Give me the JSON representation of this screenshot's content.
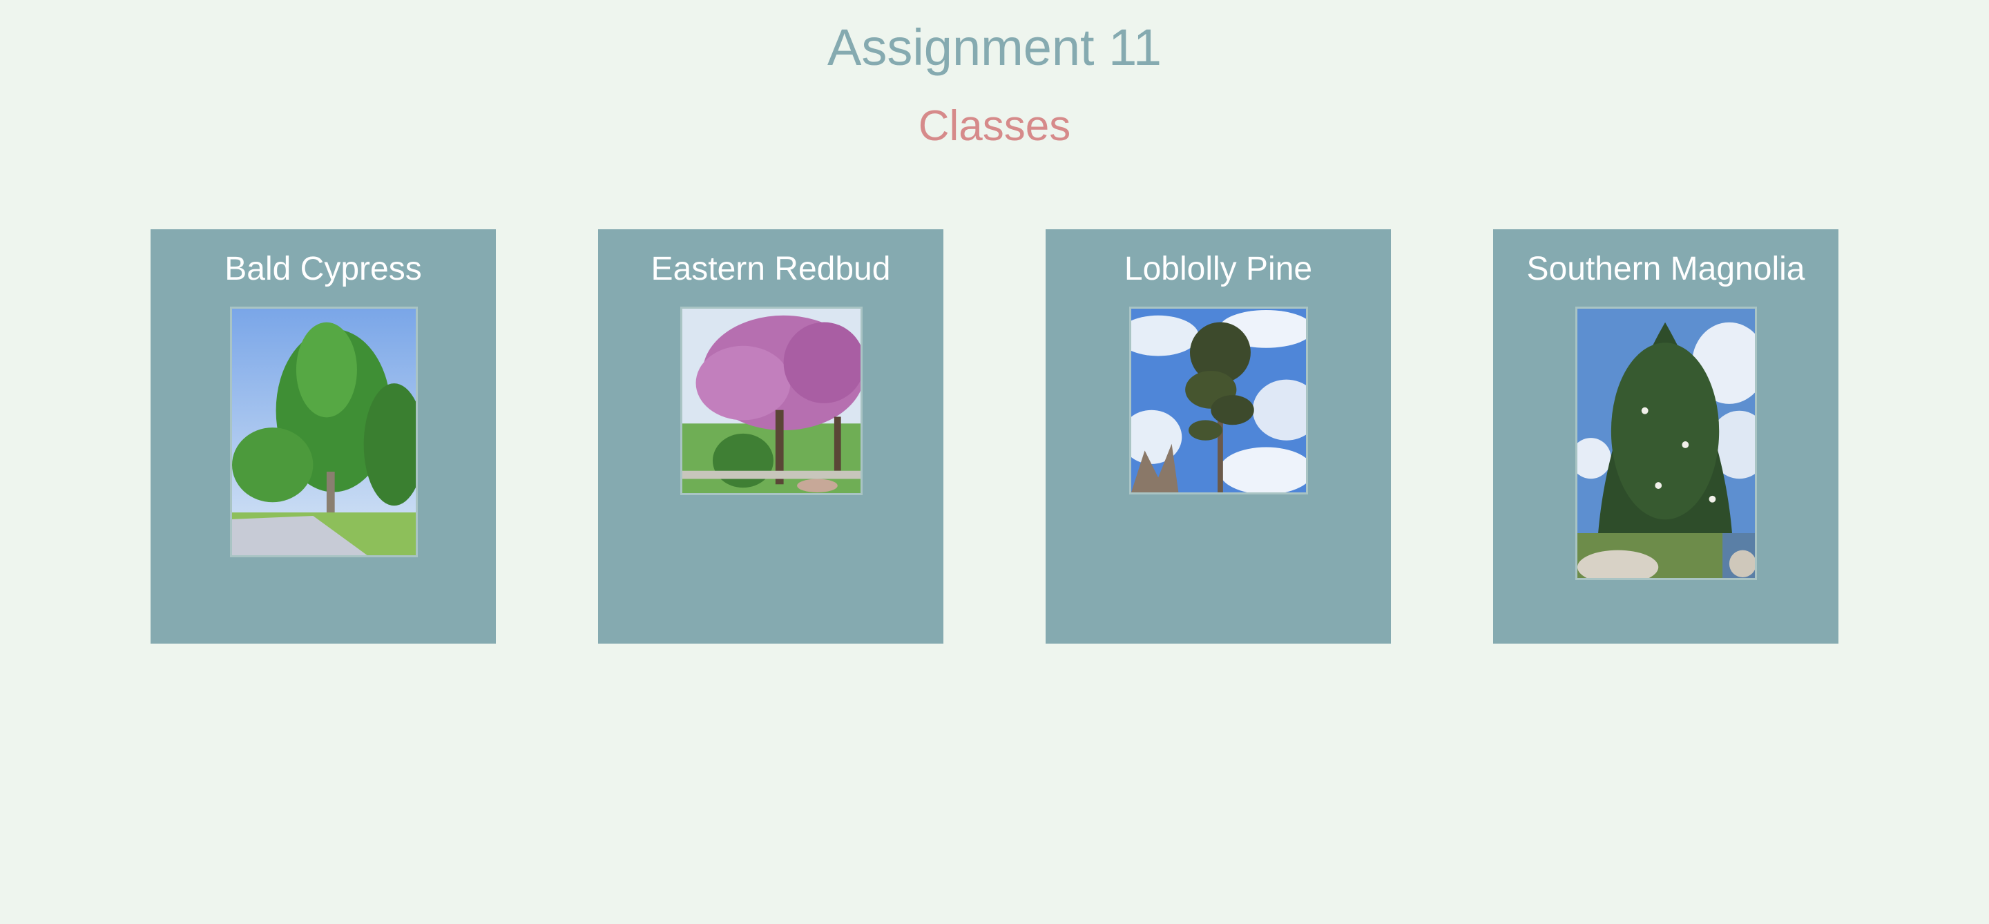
{
  "page": {
    "title": "Assignment 11",
    "subtitle": "Classes"
  },
  "cards": [
    {
      "name": "Bald Cypress",
      "image": "bald-cypress-photo"
    },
    {
      "name": "Eastern Redbud",
      "image": "eastern-redbud-photo"
    },
    {
      "name": "Loblolly Pine",
      "image": "loblolly-pine-photo"
    },
    {
      "name": "Southern Magnolia",
      "image": "southern-magnolia-photo"
    }
  ],
  "colors": {
    "background": "#eef5ee",
    "card": "#85aab0",
    "title": "#85aab0",
    "subtitle": "#d68a8a"
  }
}
